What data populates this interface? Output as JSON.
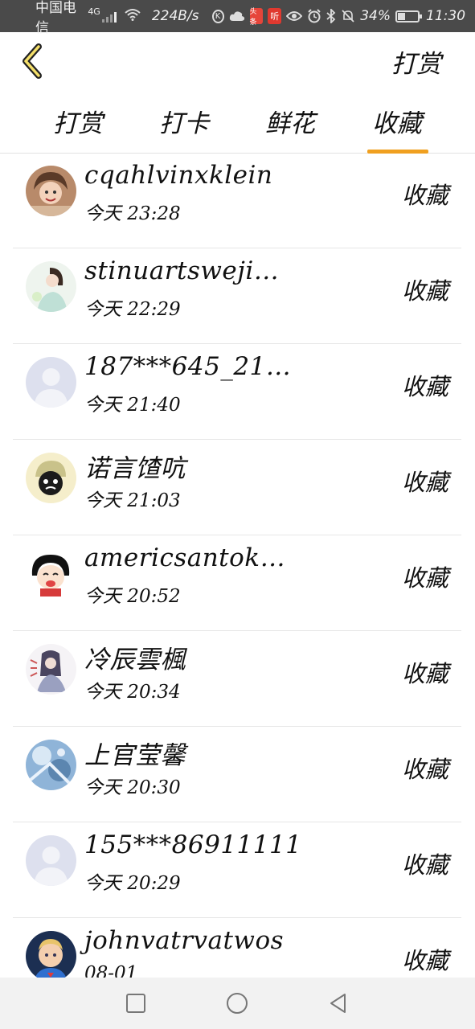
{
  "status_bar": {
    "carrier": "中国电信",
    "network": "4G",
    "speed": "224B/s",
    "news_badge": "头条",
    "listen_badge": "听",
    "k_badge": "K",
    "battery": "34%",
    "battery_level": 0.34,
    "time": "11:30"
  },
  "header": {
    "title": "打赏"
  },
  "tabs": [
    {
      "label": "打赏",
      "active": false
    },
    {
      "label": "打卡",
      "active": false
    },
    {
      "label": "鲜花",
      "active": false
    },
    {
      "label": "收藏",
      "active": true
    }
  ],
  "accent_color": "#f0a020",
  "list": [
    {
      "name": "cqahlvinxklein",
      "time": "今天 23:28",
      "action": "收藏",
      "avatar": "photo-avatar"
    },
    {
      "name": "stinuartsweji…",
      "time": "今天 22:29",
      "action": "收藏",
      "avatar": "photo-avatar"
    },
    {
      "name": "187***645_21…",
      "time": "今天 21:40",
      "action": "收藏",
      "avatar": "default-avatar"
    },
    {
      "name": "诺言馇吭",
      "time": "今天 21:03",
      "action": "收藏",
      "avatar": "cartoon-avatar"
    },
    {
      "name": "americsantok…",
      "time": "今天 20:52",
      "action": "收藏",
      "avatar": "cartoon-avatar"
    },
    {
      "name": "冷辰雲楓",
      "time": "今天 20:34",
      "action": "收藏",
      "avatar": "photo-avatar"
    },
    {
      "name": "上官莹馨",
      "time": "今天 20:30",
      "action": "收藏",
      "avatar": "photo-avatar"
    },
    {
      "name": "155***86911111",
      "time": "今天 20:29",
      "action": "收藏",
      "avatar": "default-avatar"
    },
    {
      "name": "johnvatrvatwos",
      "time": "08-01",
      "action": "收藏",
      "avatar": "photo-avatar"
    }
  ]
}
